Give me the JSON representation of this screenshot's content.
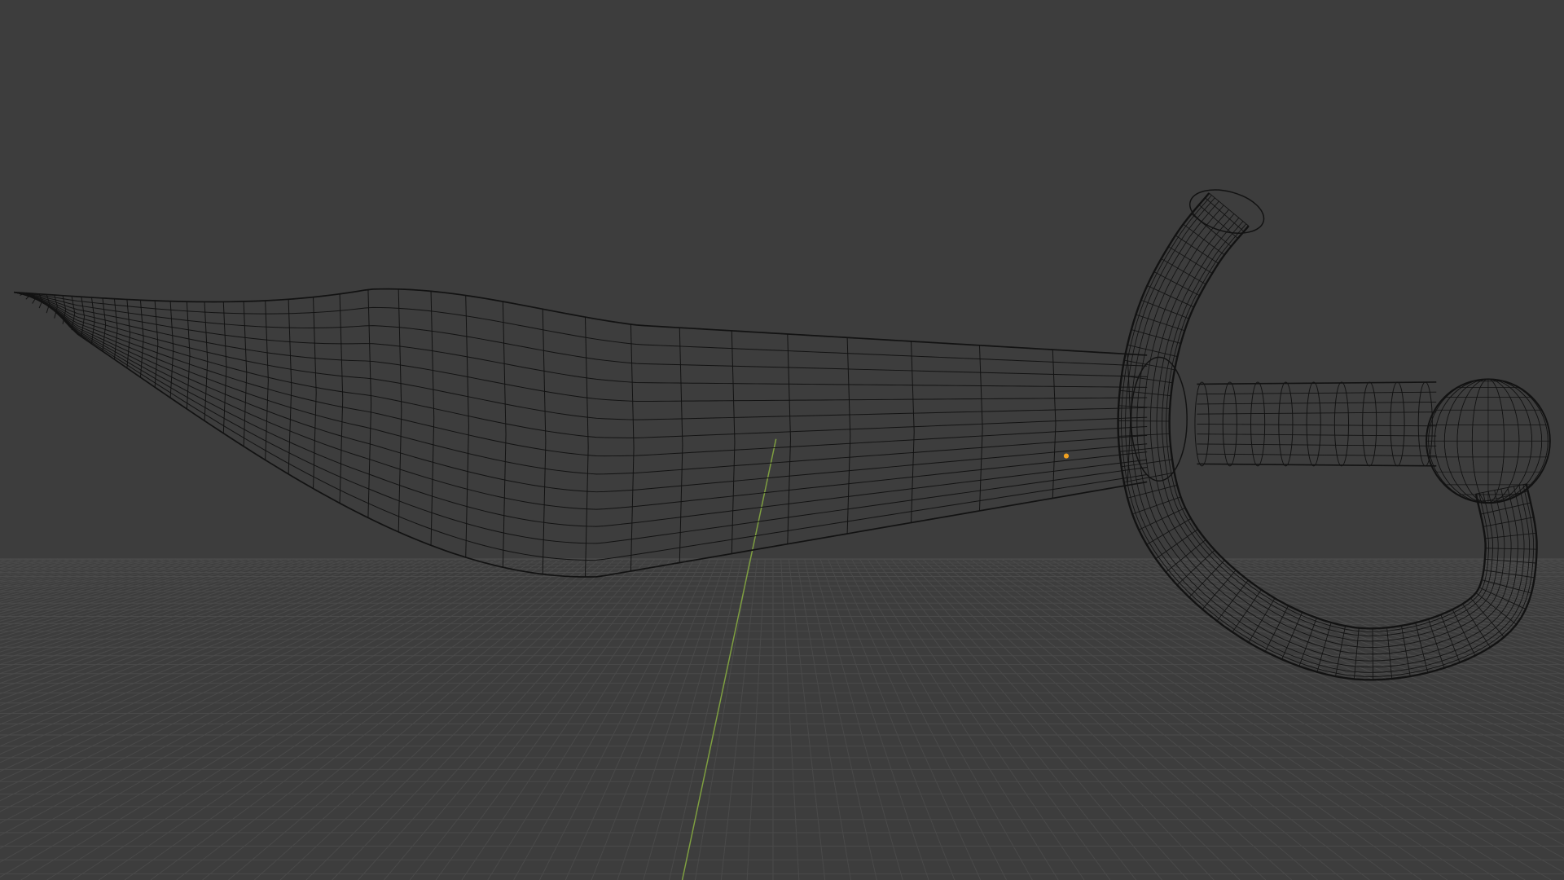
{
  "viewport": {
    "colors": {
      "background": "#3d3d3d",
      "grid": "#4a4a4a",
      "wire": "#121212",
      "y_axis": "#7fa040",
      "origin": "#f0a020"
    },
    "icons": [
      "origin-point-icon"
    ]
  }
}
